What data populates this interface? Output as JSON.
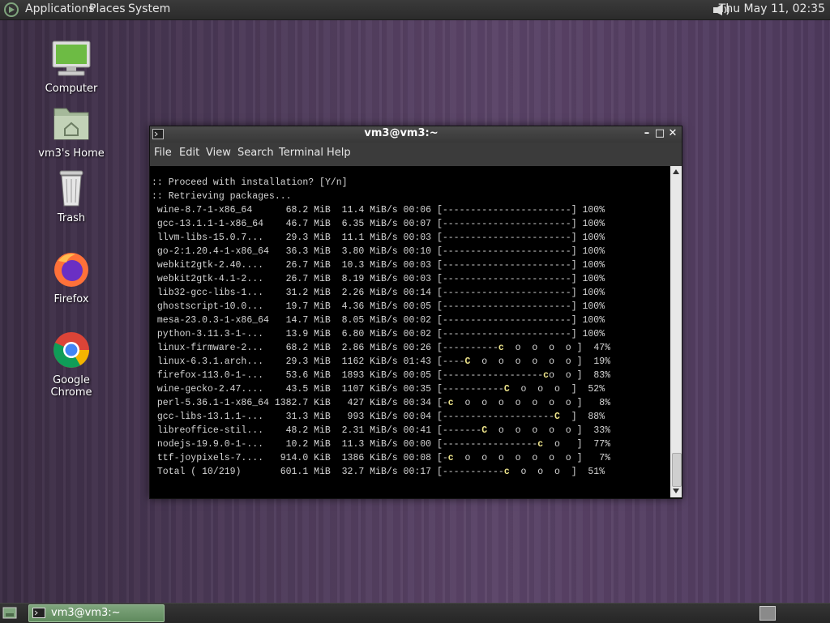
{
  "top_panel": {
    "menus": [
      "Applications",
      "Places",
      "System"
    ],
    "clock": "Thu May 11, 02:35"
  },
  "desktop": {
    "icons": [
      {
        "label": "Computer"
      },
      {
        "label": "vm3's Home"
      },
      {
        "label": "Trash"
      },
      {
        "label": "Firefox"
      },
      {
        "label": "Google Chrome"
      }
    ]
  },
  "terminal": {
    "title": "vm3@vm3:~",
    "menu": [
      "File",
      "Edit",
      "View",
      "Search",
      "Terminal",
      "Help"
    ],
    "lines": [
      ":: Proceed with installation? [Y/n]",
      ":: Retrieving packages...",
      " wine-8.7-1-x86_64      68.2 MiB  11.4 MiB/s 00:06 [-----------------------] 100%",
      " gcc-13.1.1-1-x86_64    46.7 MiB  6.35 MiB/s 00:07 [-----------------------] 100%",
      " llvm-libs-15.0.7...    29.3 MiB  11.1 MiB/s 00:03 [-----------------------] 100%",
      " go-2:1.20.4-1-x86_64   36.3 MiB  3.80 MiB/s 00:10 [-----------------------] 100%",
      " webkit2gtk-2.40....    26.7 MiB  10.3 MiB/s 00:03 [-----------------------] 100%",
      " webkit2gtk-4.1-2...    26.7 MiB  8.19 MiB/s 00:03 [-----------------------] 100%",
      " lib32-gcc-libs-1...    31.2 MiB  2.26 MiB/s 00:14 [-----------------------] 100%",
      " ghostscript-10.0...    19.7 MiB  4.36 MiB/s 00:05 [-----------------------] 100%",
      " mesa-23.0.3-1-x86_64   14.7 MiB  8.05 MiB/s 00:02 [-----------------------] 100%",
      " python-3.11.3-1-...    13.9 MiB  6.80 MiB/s 00:02 [-----------------------] 100%",
      " linux-firmware-2...    68.2 MiB  2.86 MiB/s 00:26 [----------c  o  o  o  o ]  47%",
      " linux-6.3.1.arch...    29.3 MiB  1162 KiB/s 01:43 [----C  o  o  o  o  o  o ]  19%",
      " firefox-113.0-1-...    53.6 MiB  1893 KiB/s 00:05 [------------------co  o ]  83%",
      " wine-gecko-2.47....    43.5 MiB  1107 KiB/s 00:35 [-----------C  o  o  o  ]  52%",
      " perl-5.36.1-1-x86_64 1382.7 KiB   427 KiB/s 00:34 [-c  o  o  o  o  o  o  o ]   8%",
      " gcc-libs-13.1.1-...    31.3 MiB   993 KiB/s 00:04 [--------------------C  ]  88%",
      " libreoffice-stil...    48.2 MiB  2.31 MiB/s 00:41 [-------C  o  o  o  o  o ]  33%",
      " nodejs-19.9.0-1-...    10.2 MiB  11.3 MiB/s 00:00 [-----------------c  o   ]  77%",
      " ttf-joypixels-7....   914.0 KiB  1386 KiB/s 00:08 [-c  o  o  o  o  o  o  o ]   7%",
      " Total ( 10/219)       601.1 MiB  32.7 MiB/s 00:17 [-----------c  o  o  o  ]  51%"
    ]
  },
  "bottom_panel": {
    "task_label": "vm3@vm3:~"
  },
  "colors": {
    "pacman": "#f0e68c",
    "task_active": "#6f986d"
  },
  "icons": [
    "distro-logo-icon",
    "volume-icon",
    "computer-icon",
    "home-folder-icon",
    "trash-icon",
    "firefox-icon",
    "chrome-icon",
    "terminal-icon",
    "show-desktop-icon"
  ]
}
